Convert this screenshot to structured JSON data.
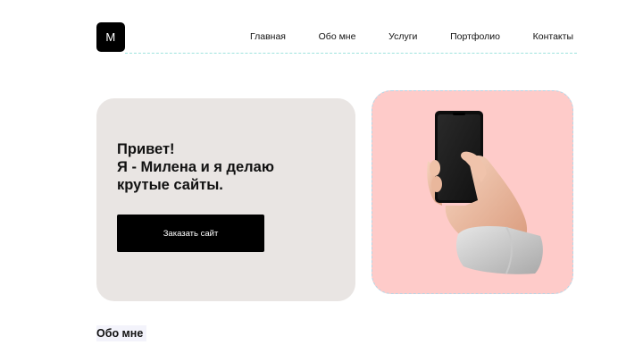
{
  "header": {
    "logo_letter": "M",
    "nav": [
      "Главная",
      "Обо мне",
      "Услуги",
      "Портфолио",
      "Контакты"
    ]
  },
  "hero": {
    "title": "Привет!\nЯ - Милена и я делаю\nкрутые сайты.",
    "cta_label": "Заказать сайт"
  },
  "image_card": {
    "icon": "hand-holding-phone-icon"
  },
  "about": {
    "label": "Обо мне"
  },
  "colors": {
    "hero_bg": "#e9e5e3",
    "image_bg": "#fecbc9",
    "button_bg": "#000000",
    "accent_line": "#9fe3de"
  }
}
